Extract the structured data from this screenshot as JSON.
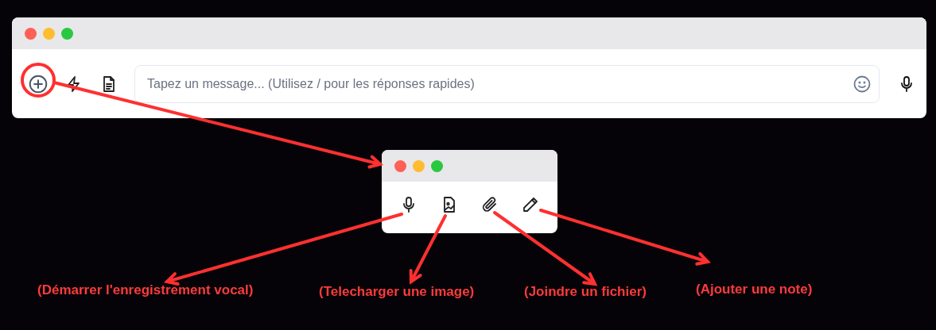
{
  "main_window": {
    "message_field": {
      "placeholder": "Tapez un message... (Utilisez / pour les réponses rapides)"
    }
  },
  "annotations": [
    {
      "label": "(Démarrer l'enregistrement vocal)"
    },
    {
      "label": "(Telecharger une image)"
    },
    {
      "label": "(Joindre un fichier)"
    },
    {
      "label": "(Ajouter une note)"
    }
  ]
}
